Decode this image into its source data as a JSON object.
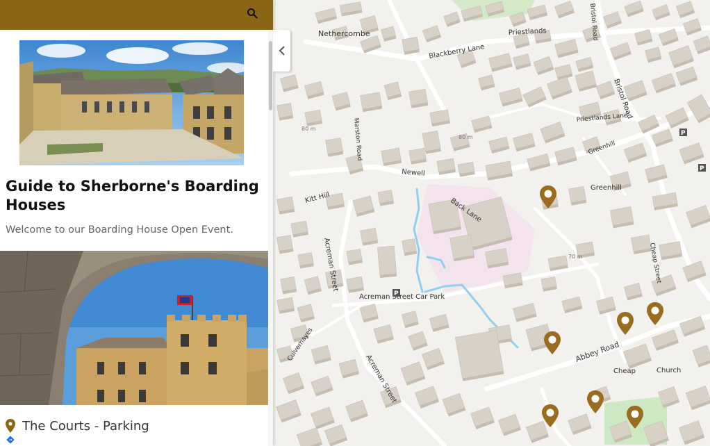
{
  "colors": {
    "accent": "#8a6516",
    "marker": "#9a6d1e",
    "map_bg": "#f2f1ee",
    "building": "#d7d1c7",
    "building_top": "#c6bdb0",
    "water": "#8fd0f2",
    "campus": "#f3e3ec",
    "green": "#cfe8c4"
  },
  "header": {
    "search_icon": "search-icon"
  },
  "sidebar": {
    "title": "Guide to Sherborne's Boarding Houses",
    "subtitle": "Welcome to our Boarding House Open Event.",
    "location": {
      "label": "The Courts - Parking",
      "icon": "map-pin-icon",
      "directions_icon": "directions-icon"
    },
    "collapse_icon": "chevron-left-icon"
  },
  "map": {
    "labels": {
      "netherscombe": "Nethercombe",
      "priestlands": "Priestlands",
      "blackberry_lane": "Blackberry Lane",
      "bristol_road": "Bristol Road",
      "priestlands_lane": "Priestlands Lane",
      "greenhill_a": "Greenhill",
      "greenhill_b": "Greenhill",
      "back_lane": "Back Lane",
      "newell": "Newell",
      "kitt_hill": "Kitt Hill",
      "acreman_street_a": "Acreman Street",
      "acreman_street_b": "Acreman Street",
      "acreman_car_park": "Acreman Street Car Park",
      "abbey_road": "Abbey Road",
      "cheap_street": "Cheap Street",
      "cheap": "Cheap",
      "church": "Church",
      "culverhayes": "Culverhayes",
      "marston_road": "Marston Road",
      "elev_80a": "80 m",
      "elev_80b": "80 m",
      "elev_70": "70 m",
      "parking_a": "P",
      "parking_b": "P",
      "parking_c": "P"
    },
    "marker_count_label": "7"
  }
}
